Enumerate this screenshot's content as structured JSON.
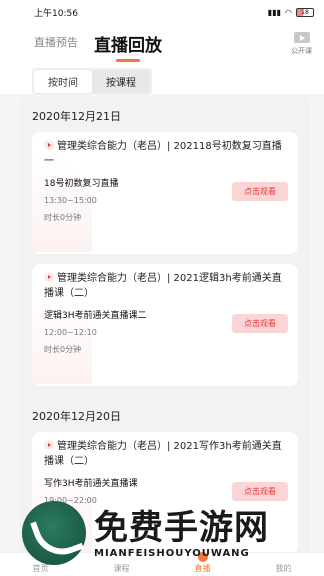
{
  "status_bar": {
    "time": "上午10:56",
    "signal": "▮▮▮",
    "wifi": "wifi",
    "battery": "18"
  },
  "header": {
    "tab_live": "直播预告",
    "tab_replay": "直播回放",
    "public_course": "公开课"
  },
  "subtabs": {
    "by_time": "按时间",
    "by_course": "按课程"
  },
  "sections": [
    {
      "date": "2020年12月21日",
      "items": [
        {
          "title": "管理类综合能力（老吕）| 202118号初数复习直播一",
          "subtitle": "18号初数复习直播",
          "time": "13:30~15:00",
          "duration": "时长0分钟",
          "button": "点击观看"
        },
        {
          "title": "管理类综合能力（老吕）| 2021逻辑3h考前通关直播课（二）",
          "subtitle": "逻辑3H考前通关直播课二",
          "time": "12:00~12:10",
          "duration": "时长0分钟",
          "button": "点击观看"
        }
      ]
    },
    {
      "date": "2020年12月20日",
      "items": [
        {
          "title": "管理类综合能力（老吕）| 2021写作3h考前通关直播课（二）",
          "subtitle": "写作3H考前通关直播课",
          "time": "19:00~22:00",
          "duration": "",
          "button": "点击观看"
        }
      ]
    }
  ],
  "bottom_nav": [
    "首页",
    "课程",
    "直播",
    "我的"
  ],
  "watermark": {
    "cn": "免费手游网",
    "en": "MIANFEISHOUYOUWANG"
  },
  "colors": {
    "accent": "#f07a3c",
    "button_bg": "#fbd5d5",
    "button_text": "#e53935"
  }
}
